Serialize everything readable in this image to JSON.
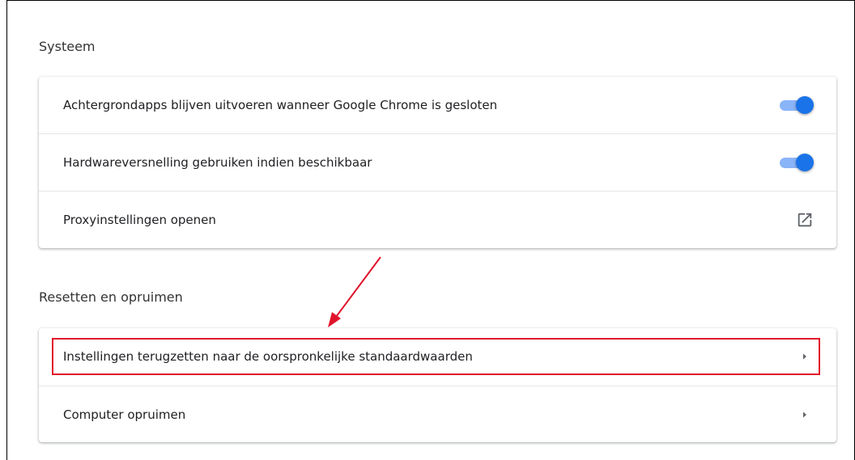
{
  "systeem": {
    "title": "Systeem",
    "rows": [
      {
        "label": "Achtergrondapps blijven uitvoeren wanneer Google Chrome is gesloten",
        "control": "toggle",
        "enabled": true
      },
      {
        "label": "Hardwareversnelling gebruiken indien beschikbaar",
        "control": "toggle",
        "enabled": true
      },
      {
        "label": "Proxyinstellingen openen",
        "control": "open-in-new-icon"
      }
    ]
  },
  "reset": {
    "title": "Resetten en opruimen",
    "rows": [
      {
        "label": "Instellingen terugzetten naar de oorspronkelijke standaardwaarden",
        "control": "chevron-right-icon",
        "highlighted": true
      },
      {
        "label": "Computer opruimen",
        "control": "chevron-right-icon"
      }
    ]
  },
  "colors": {
    "toggle_track": "#8ab4f8",
    "toggle_knob": "#1a73e8",
    "annotation": "#e0142b"
  }
}
